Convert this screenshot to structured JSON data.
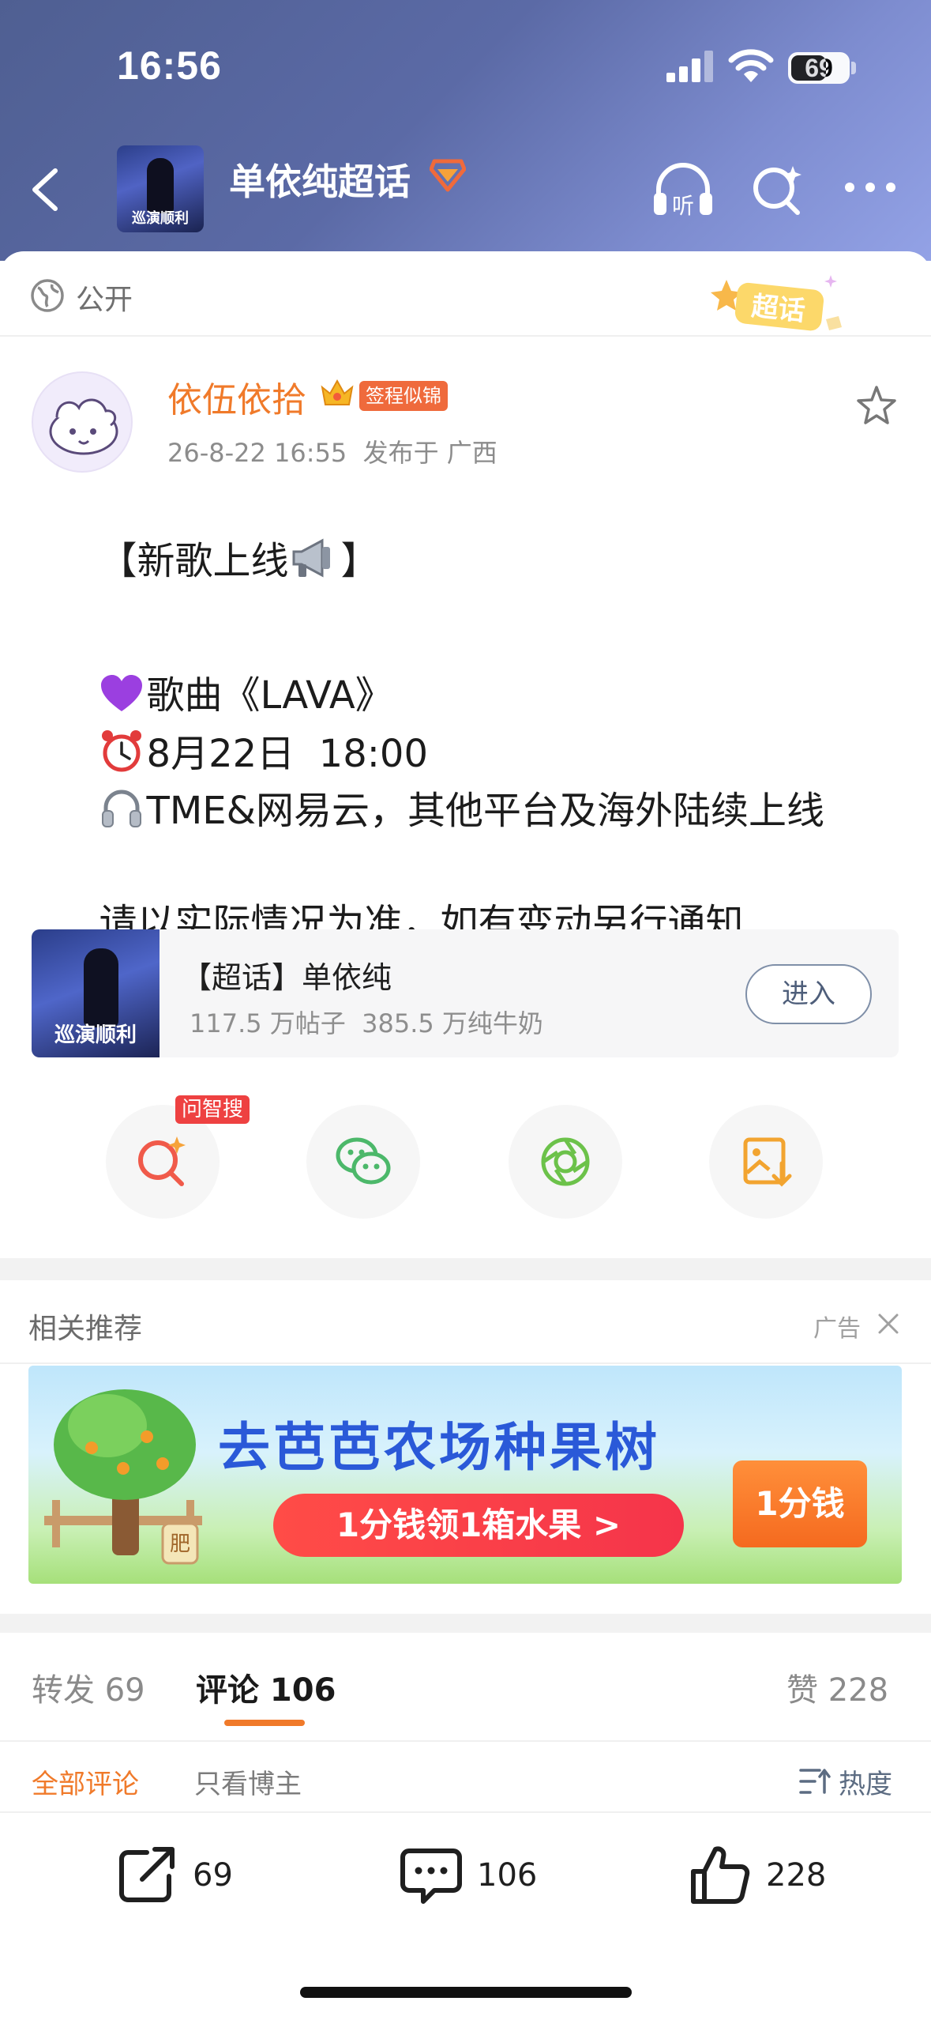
{
  "status_bar": {
    "time": "16:56",
    "battery": "69"
  },
  "nav": {
    "title": "单依纯超话",
    "avatar_caption": "巡演顺利"
  },
  "visibility": {
    "label": "公开",
    "badge": "超话"
  },
  "author": {
    "name": "依伍依拾",
    "badge": "签程似锦",
    "meta": "26-8-22 16:55  发布于 广西"
  },
  "post": {
    "line1": "【新歌上线",
    "line1_end": "】",
    "line2": "歌曲《LAVA》",
    "line3": "8月22日  18:00",
    "line4": "TME&网易云，其他平台及海外陆续上线",
    "line5": "请以实际情况为准，如有变动另行通知"
  },
  "topic_card": {
    "title": "【超话】单依纯",
    "stats": "117.5 万帖子  385.5 万纯牛奶",
    "enter": "进入",
    "thumb_caption": "巡演顺利"
  },
  "share": {
    "search_tag": "问智搜"
  },
  "recommend": {
    "title": "相关推荐",
    "ad_label": "广告"
  },
  "ad": {
    "headline": "去芭芭农场种果树",
    "cta": "1分钱领1箱水果 >",
    "price": "1分钱",
    "tree_label": "肥"
  },
  "tabs": {
    "repost": "转发 69",
    "comment": "评论 106",
    "like": "赞 228"
  },
  "filter": {
    "all": "全部评论",
    "blogger": "只看博主",
    "sort": "热度"
  },
  "bottom_bar": {
    "repost_count": "69",
    "comment_count": "106",
    "like_count": "228"
  },
  "colors": {
    "accent": "#f07a2a",
    "header": "#5b6aa6",
    "badge_red": "#ef6a3c"
  }
}
